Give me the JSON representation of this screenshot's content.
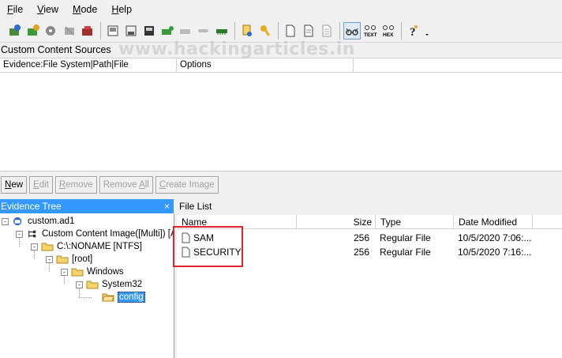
{
  "menu": [
    "File",
    "View",
    "Mode",
    "Help"
  ],
  "menu_underline": [
    "F",
    "V",
    "M",
    "H"
  ],
  "watermark": "www.hackingarticles.in",
  "custom_content": {
    "title": "Custom Content Sources",
    "columns": [
      "Evidence:File System|Path|File",
      "Options"
    ]
  },
  "buttons": [
    {
      "label": "New",
      "underline": "N",
      "enabled": true
    },
    {
      "label": "Edit",
      "underline": "E",
      "enabled": false
    },
    {
      "label": "Remove",
      "underline": "R",
      "enabled": false
    },
    {
      "label": "Remove All",
      "underline": "A",
      "enabled": false
    },
    {
      "label": "Create Image",
      "underline": "C",
      "enabled": false
    }
  ],
  "evidence_tree": {
    "title": "Evidence Tree",
    "close": "×",
    "nodes": [
      {
        "label": "custom.ad1",
        "icon": "evidence-icon",
        "expander": "-"
      },
      {
        "label": "Custom Content Image([Multi]) [AD",
        "icon": "tree-structure-icon",
        "expander": "-"
      },
      {
        "label": "C:\\:NONAME [NTFS]",
        "icon": "folder-icon",
        "expander": "-"
      },
      {
        "label": "[root]",
        "icon": "folder-icon",
        "expander": "-"
      },
      {
        "label": "Windows",
        "icon": "folder-icon",
        "expander": "-"
      },
      {
        "label": "System32",
        "icon": "folder-icon",
        "expander": "-"
      },
      {
        "label": "config",
        "icon": "folder-open-icon",
        "expander": "",
        "selected": true
      }
    ]
  },
  "file_list": {
    "title": "File List",
    "columns": [
      "Name",
      "Size",
      "Type",
      "Date Modified"
    ],
    "rows": [
      {
        "name": "SAM",
        "size": "256",
        "type": "Regular File",
        "date": "10/5/2020 7:06:..."
      },
      {
        "name": "SECURITY",
        "size": "256",
        "type": "Regular File",
        "date": "10/5/2020 7:16:..."
      }
    ]
  },
  "colors": {
    "selection": "#3399ff",
    "highlight_box": "#e0242c",
    "folder": "#f5d36b"
  }
}
